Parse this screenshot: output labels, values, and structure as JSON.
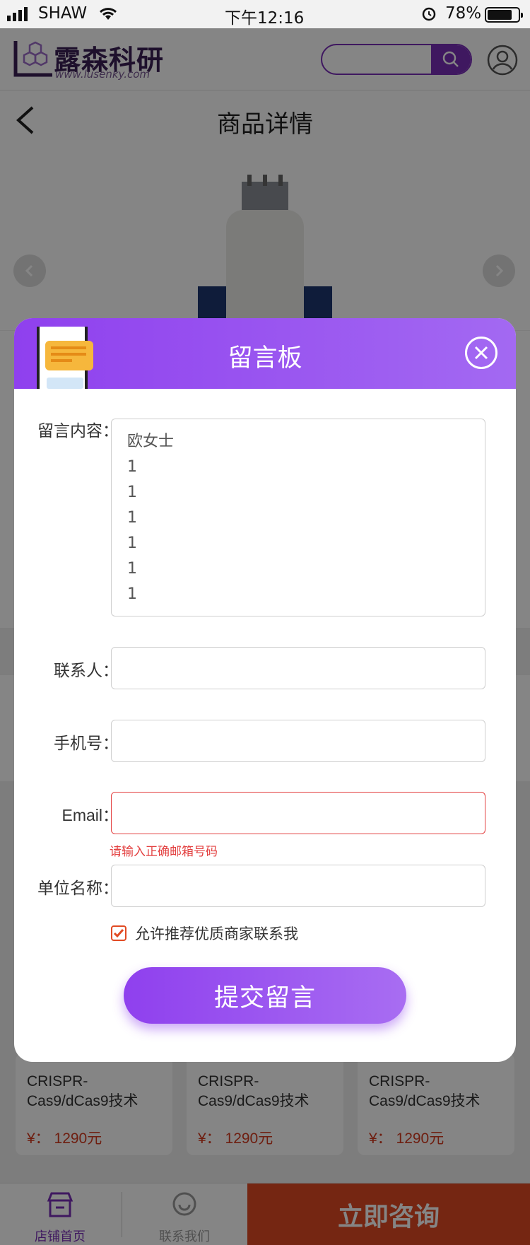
{
  "status_bar": {
    "carrier": "SHAW",
    "time": "下午12:16",
    "battery": "78%"
  },
  "header": {
    "logo_name": "露森科研",
    "logo_url": "www.lusenky.com",
    "search_placeholder": ""
  },
  "titlebar": {
    "title": "商品详情"
  },
  "products": [
    {
      "name": "CRISPR-Cas9/dCas9技术",
      "price": "¥： 1290元"
    },
    {
      "name": "CRISPR-Cas9/dCas9技术",
      "price": "¥： 1290元"
    },
    {
      "name": "CRISPR-Cas9/dCas9技术",
      "price": "¥： 1290元"
    }
  ],
  "bottom_nav": {
    "home": "店铺首页",
    "contact": "联系我们",
    "consult": "立即咨询"
  },
  "modal": {
    "title": "留言板",
    "fields": {
      "message_label": "留言内容：",
      "message_value": "欧女士\n1\n1\n1\n1\n1\n1",
      "contact_label": "联系人：",
      "contact_value": "",
      "phone_label": "手机号：",
      "phone_value": "",
      "email_label": "Email：",
      "email_value": "",
      "email_error": "请输入正确邮箱号码",
      "company_label": "单位名称：",
      "company_value": ""
    },
    "consent_label": "允许推荐优质商家联系我",
    "consent_checked": true,
    "submit_label": "提交留言"
  },
  "colors": {
    "accent": "#8f40ee",
    "consult": "#e14a23",
    "error": "#e34040"
  }
}
